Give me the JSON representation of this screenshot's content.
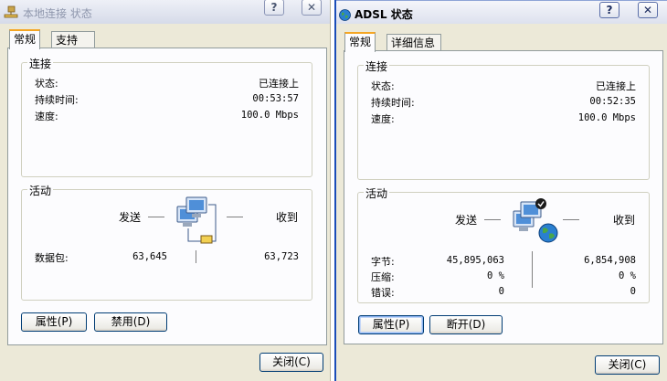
{
  "left_window": {
    "title": "本地连接 状态",
    "help_glyph": "?",
    "close_glyph": "✕",
    "tabs": [
      {
        "label": "常规",
        "active": true
      },
      {
        "label": "支持",
        "active": false
      }
    ],
    "connection": {
      "group_label": "连接",
      "status_label": "状态:",
      "status_value": "已连接上",
      "duration_label": "持续时间:",
      "duration_value": "00:53:57",
      "speed_label": "速度:",
      "speed_value": "100.0 Mbps"
    },
    "activity": {
      "group_label": "活动",
      "sent_label": "发送",
      "received_label": "收到",
      "packets_label": "数据包:",
      "packets_sent": "63,645",
      "packets_received": "63,723"
    },
    "buttons": {
      "properties": "属性(P)",
      "disable": "禁用(D)",
      "close": "关闭(C)"
    }
  },
  "right_window": {
    "title": "ADSL 状态",
    "help_glyph": "?",
    "close_glyph": "✕",
    "tabs": [
      {
        "label": "常规",
        "active": true
      },
      {
        "label": "详细信息",
        "active": false
      }
    ],
    "connection": {
      "group_label": "连接",
      "status_label": "状态:",
      "status_value": "已连接上",
      "duration_label": "持续时间:",
      "duration_value": "00:52:35",
      "speed_label": "速度:",
      "speed_value": "100.0 Mbps"
    },
    "activity": {
      "group_label": "活动",
      "sent_label": "发送",
      "received_label": "收到",
      "bytes_label": "字节:",
      "bytes_sent": "45,895,063",
      "bytes_received": "6,854,908",
      "compression_label": "压缩:",
      "compression_sent": "0 %",
      "compression_received": "0 %",
      "errors_label": "错误:",
      "errors_sent": "0",
      "errors_received": "0"
    },
    "buttons": {
      "properties": "属性(P)",
      "disconnect": "断开(D)",
      "close": "关闭(C)"
    }
  },
  "colors": {
    "window_bg": "#ece9d8",
    "tab_highlight": "#f5a623",
    "title_accent": "#1a4db8"
  },
  "icons": [
    "network-connection-icon",
    "globe-icon",
    "computers-activity-icon",
    "computers-globe-activity-icon"
  ]
}
